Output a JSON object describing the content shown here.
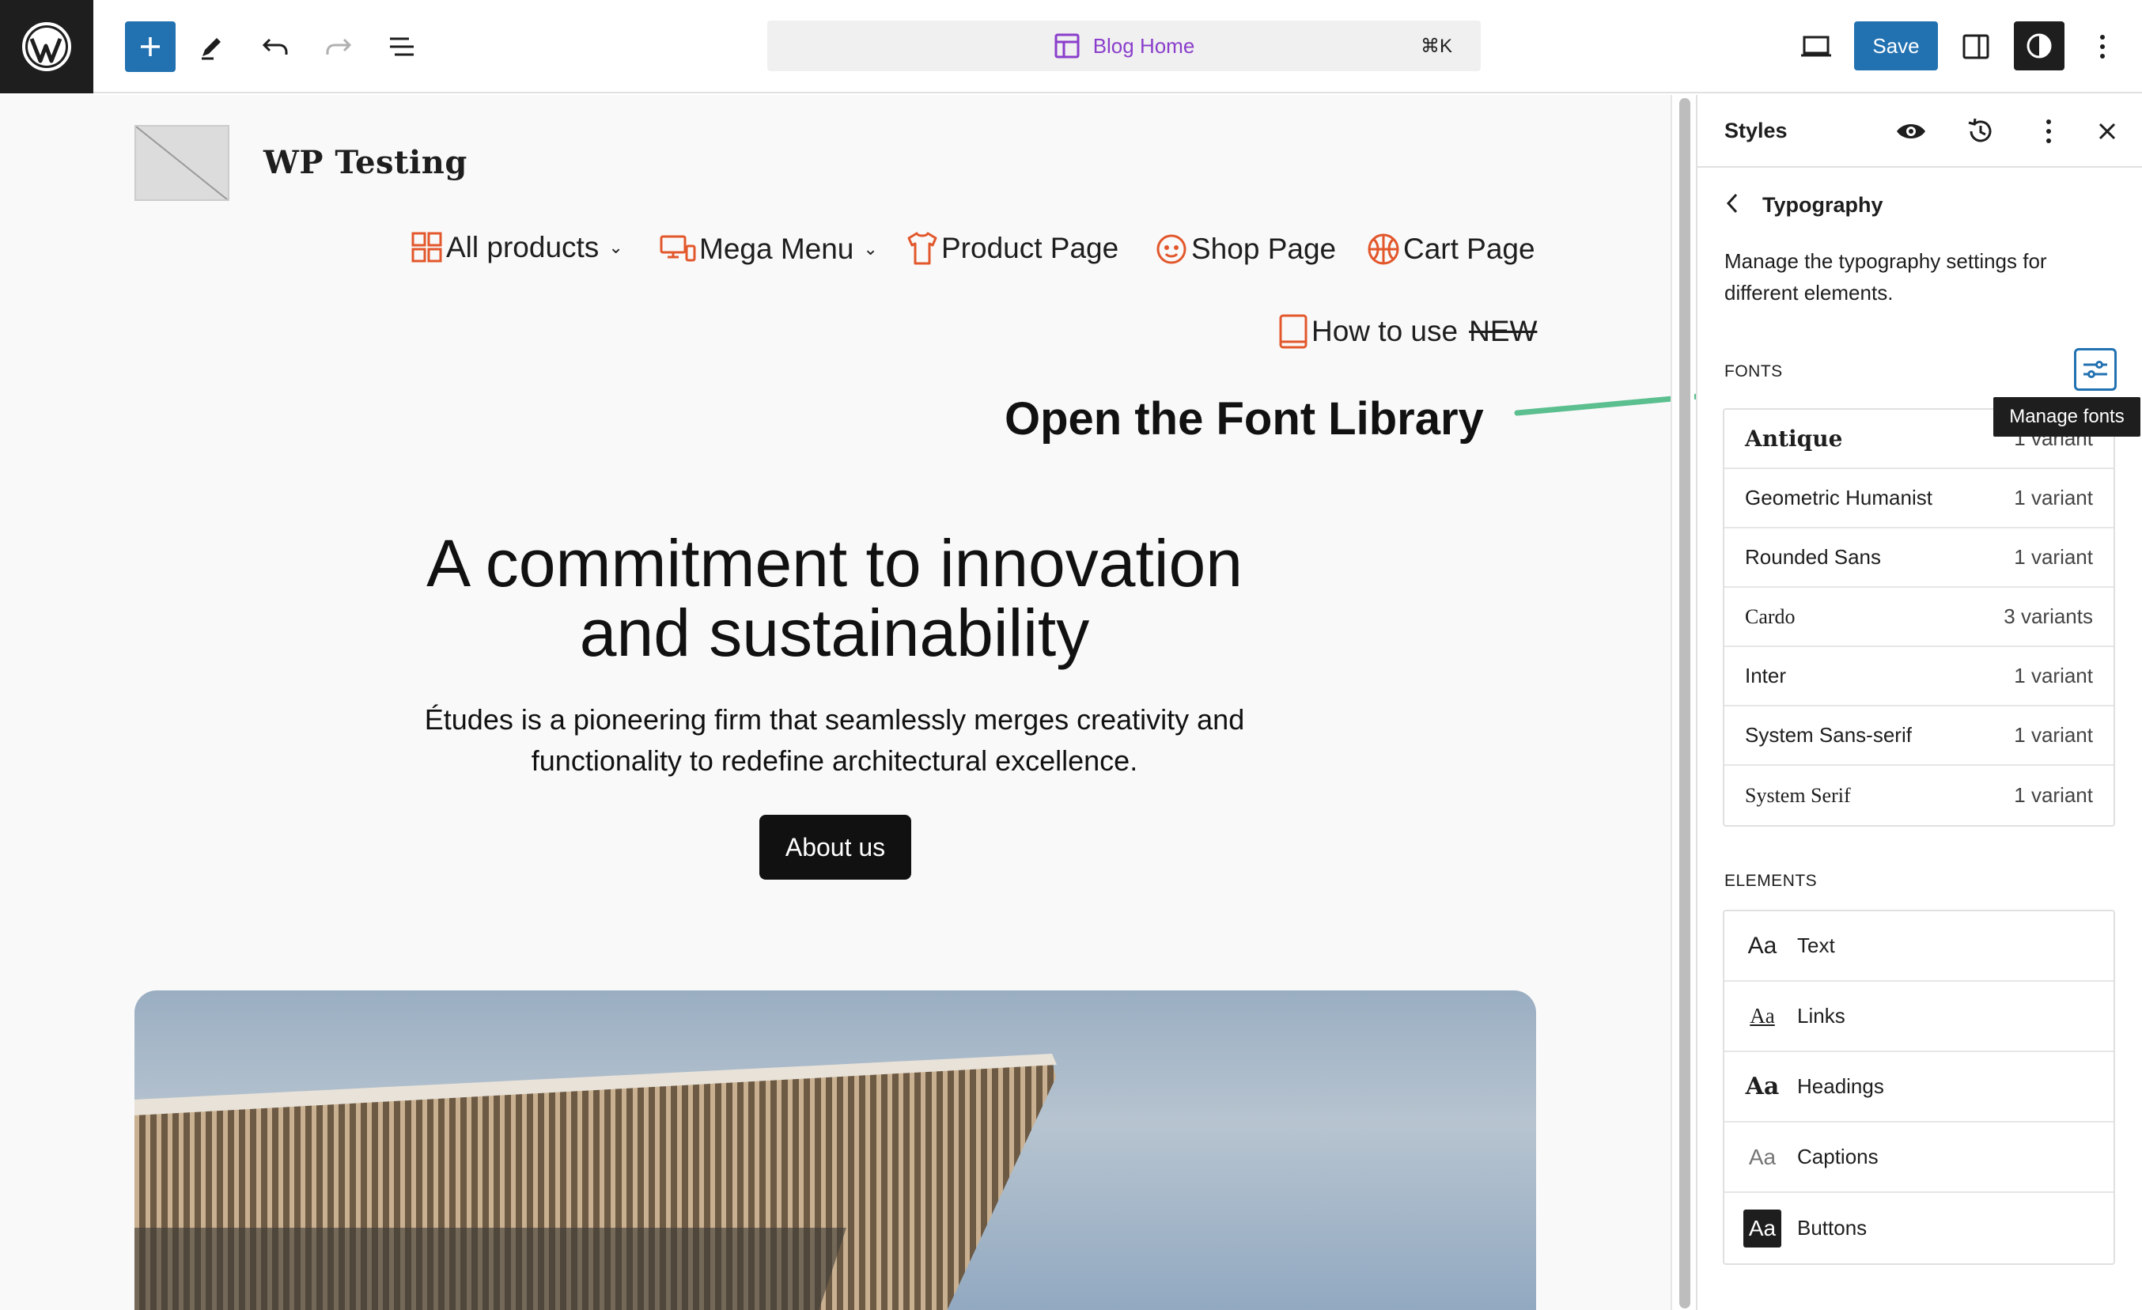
{
  "toolbar": {
    "document_title": "Blog Home",
    "shortcut": "⌘K",
    "save_label": "Save"
  },
  "site": {
    "title": "WP Testing"
  },
  "nav": {
    "items": [
      {
        "label": "All products",
        "icon": "grid-icon"
      },
      {
        "label": "Mega Menu",
        "icon": "devices-icon"
      },
      {
        "label": "Product Page",
        "icon": "shirt-icon"
      },
      {
        "label": "Shop Page",
        "icon": "baby-face-icon"
      },
      {
        "label": "Cart Page",
        "icon": "basketball-icon"
      },
      {
        "label": "How to use",
        "icon": "book-icon",
        "suffix": "NEW"
      }
    ]
  },
  "annotation": {
    "text": "Open the Font Library",
    "arrow_color": "#5bbf8f"
  },
  "hero": {
    "title_line1": "A commitment to innovation",
    "title_line2": "and sustainability",
    "subtitle_line1": "Études is a pioneering firm that seamlessly merges creativity and",
    "subtitle_line2": "functionality to redefine architectural excellence.",
    "button_label": "About us"
  },
  "sidebar": {
    "title": "Styles",
    "section_title": "Typography",
    "description": "Manage the typography settings for different elements.",
    "fonts_label": "FONTS",
    "manage_tooltip": "Manage fonts",
    "fonts": [
      {
        "name": "Antique",
        "variants": "1 variant"
      },
      {
        "name": "Geometric Humanist",
        "variants": "1 variant"
      },
      {
        "name": "Rounded Sans",
        "variants": "1 variant"
      },
      {
        "name": "Cardo",
        "variants": "3 variants"
      },
      {
        "name": "Inter",
        "variants": "1 variant"
      },
      {
        "name": "System Sans-serif",
        "variants": "1 variant"
      },
      {
        "name": "System Serif",
        "variants": "1 variant"
      }
    ],
    "elements_label": "ELEMENTS",
    "elements": [
      {
        "label": "Text",
        "preview": "Aa"
      },
      {
        "label": "Links",
        "preview": "Aa"
      },
      {
        "label": "Headings",
        "preview": "Aa"
      },
      {
        "label": "Captions",
        "preview": "Aa"
      },
      {
        "label": "Buttons",
        "preview": "Aa"
      }
    ]
  },
  "colors": {
    "accent": "#2271b1",
    "nav_icon": "#e2572b",
    "command_title": "#8a3ecb",
    "dark": "#1e1e1e"
  }
}
